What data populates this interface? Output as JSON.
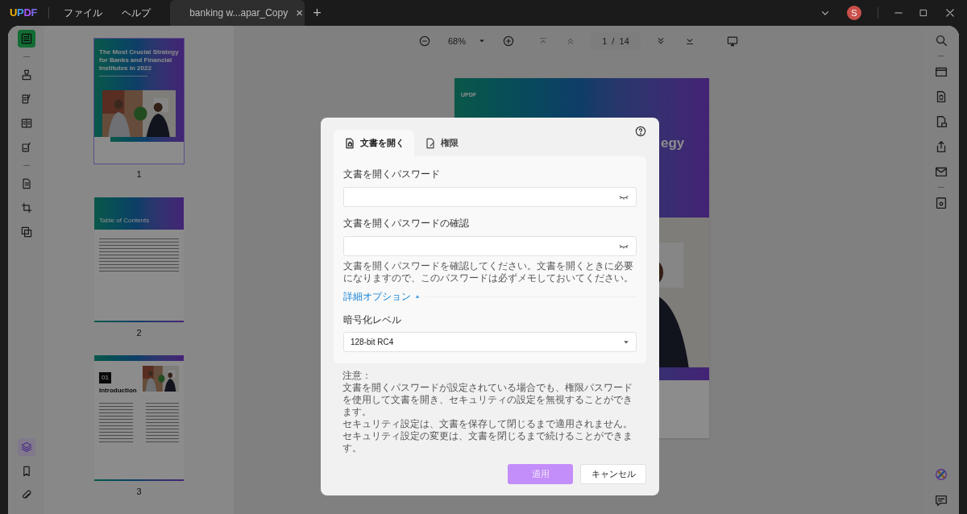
{
  "titlebar": {
    "logo": "UPDF",
    "menus": [
      "ファイル",
      "ヘルプ"
    ],
    "tab": {
      "title": "banking w...apar_Copy",
      "close": "×"
    },
    "new_tab": "+",
    "avatar": "S"
  },
  "toolbar": {
    "zoom": "68%",
    "page": "1",
    "page_total": "/  14"
  },
  "left_tools": [
    {
      "selected": true
    },
    {
      "selected": false
    },
    {
      "selected": false
    },
    {
      "selected": false
    },
    {
      "selected": false
    },
    {
      "selected": false
    },
    {
      "selected": false
    },
    {
      "selected": false
    }
  ],
  "left_bottom_tools": [
    {
      "selected": true
    },
    {
      "selected": false
    },
    {
      "selected": false
    }
  ],
  "thumbnails": [
    {
      "kind": "cover",
      "number": "1",
      "selected": true,
      "title": "The Most Crucial Strategy for Banks and Financial Institutes in 2022"
    },
    {
      "kind": "toc",
      "number": "2",
      "selected": false,
      "title": "Table of Contents"
    },
    {
      "kind": "chapter",
      "number": "3",
      "selected": false,
      "badge": "01",
      "title": "Introduction"
    }
  ],
  "page": {
    "logo": "UPDF",
    "title_fragments": [
      "egy"
    ]
  },
  "dialog": {
    "tabs": [
      {
        "label": "文書を開く",
        "selected": true
      },
      {
        "label": "権限",
        "selected": false
      }
    ],
    "password_label": "文書を開くパスワード",
    "confirm_label": "文書を開くパスワードの確認",
    "hint": "文書を開くパスワードを確認してください。文書を開くときに必要になりますので、このパスワードは必ずメモしておいてください。",
    "advanced": {
      "label": "詳細オプション",
      "expanded": true
    },
    "encryption_label": "暗号化レベル",
    "encryption_value": "128-bit RC4",
    "notes": [
      "注意：",
      "文書を開くパスワードが設定されている場合でも、権限パスワードを使用して文書を開き、セキュリティの設定を無視することができます。",
      "セキュリティ設定は、文書を保存して閉じるまで適用されません。セキュリティ設定の変更は、文書を閉じるまで続けることができます。"
    ],
    "apply": {
      "label": "適用",
      "disabled": true
    },
    "cancel": "キャンセル"
  }
}
